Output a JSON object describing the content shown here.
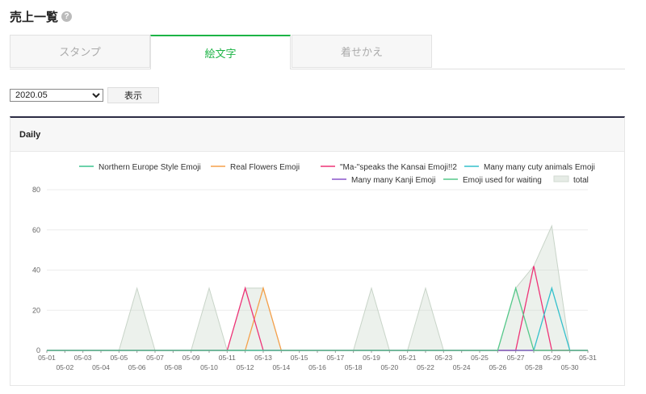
{
  "page": {
    "title": "売上一覧",
    "help_icon": "question-circle-icon"
  },
  "tabs": [
    {
      "label": "スタンプ",
      "active": false
    },
    {
      "label": "絵文字",
      "active": true
    },
    {
      "label": "着せかえ",
      "active": false
    }
  ],
  "controls": {
    "period_value": "2020.05",
    "show_label": "表示"
  },
  "panel": {
    "title": "Daily"
  },
  "chart_data": {
    "type": "line",
    "x": [
      "05-01",
      "05-02",
      "05-03",
      "05-04",
      "05-05",
      "05-06",
      "05-07",
      "05-08",
      "05-09",
      "05-10",
      "05-11",
      "05-12",
      "05-13",
      "05-14",
      "05-15",
      "05-16",
      "05-17",
      "05-18",
      "05-19",
      "05-20",
      "05-21",
      "05-22",
      "05-23",
      "05-24",
      "05-25",
      "05-26",
      "05-27",
      "05-28",
      "05-29",
      "05-30",
      "05-31"
    ],
    "ylim": [
      0,
      80
    ],
    "yticks": [
      0,
      20,
      40,
      60,
      80
    ],
    "grid": true,
    "legend_position": "top-right",
    "series": [
      {
        "name": "Northern Europe Style Emoji",
        "color": "#3cc48f",
        "values": [
          0,
          0,
          0,
          0,
          0,
          0,
          0,
          0,
          0,
          0,
          0,
          0,
          0,
          0,
          0,
          0,
          0,
          0,
          0,
          0,
          0,
          0,
          0,
          0,
          0,
          0,
          0,
          0,
          0,
          0,
          0
        ]
      },
      {
        "name": "Real Flowers Emoji",
        "color": "#f5a04a",
        "values": [
          0,
          0,
          0,
          0,
          0,
          0,
          0,
          0,
          0,
          0,
          0,
          0,
          31,
          0,
          0,
          0,
          0,
          0,
          0,
          0,
          0,
          0,
          0,
          0,
          0,
          0,
          0,
          0,
          0,
          0,
          0
        ]
      },
      {
        "name": "\"Ma-\"speaks the Kansai Emoji!!2",
        "color": "#ee3377",
        "values": [
          0,
          0,
          0,
          0,
          0,
          0,
          0,
          0,
          0,
          0,
          0,
          31,
          0,
          0,
          0,
          0,
          0,
          0,
          0,
          0,
          0,
          0,
          0,
          0,
          0,
          0,
          0,
          42,
          0,
          0,
          0
        ]
      },
      {
        "name": "Many many cuty animals Emoji",
        "color": "#33c0cc",
        "values": [
          0,
          0,
          0,
          0,
          0,
          0,
          0,
          0,
          0,
          0,
          0,
          0,
          0,
          0,
          0,
          0,
          0,
          0,
          0,
          0,
          0,
          0,
          0,
          0,
          0,
          0,
          0,
          0,
          31,
          0,
          0
        ]
      },
      {
        "name": "Many many Kanji Emoji",
        "color": "#8a55cc",
        "values": [
          0,
          0,
          0,
          0,
          0,
          0,
          0,
          0,
          0,
          0,
          0,
          0,
          0,
          0,
          0,
          0,
          0,
          0,
          0,
          0,
          0,
          0,
          0,
          0,
          0,
          0,
          0,
          0,
          0,
          0,
          0
        ]
      },
      {
        "name": "Emoji used for waiting",
        "color": "#55c88a",
        "values": [
          0,
          0,
          0,
          0,
          0,
          0,
          0,
          0,
          0,
          0,
          0,
          0,
          0,
          0,
          0,
          0,
          0,
          0,
          0,
          0,
          0,
          0,
          0,
          0,
          0,
          0,
          31,
          0,
          0,
          0,
          0
        ]
      },
      {
        "name": "total",
        "color": "#dde6dd",
        "area": true,
        "values": [
          0,
          0,
          0,
          0,
          0,
          31,
          0,
          0,
          0,
          31,
          0,
          31,
          31,
          0,
          0,
          0,
          0,
          0,
          31,
          0,
          0,
          31,
          0,
          0,
          0,
          0,
          31,
          42,
          62,
          0,
          0
        ]
      }
    ]
  }
}
